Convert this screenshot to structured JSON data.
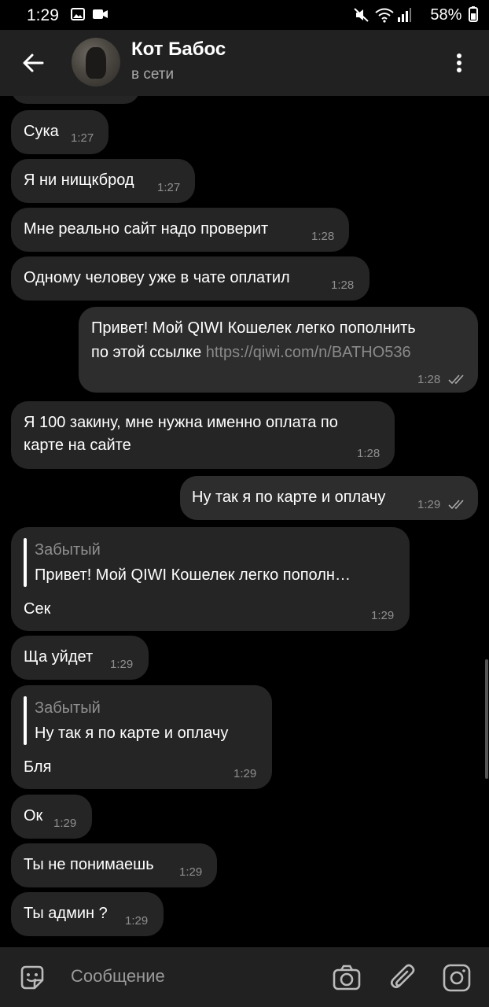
{
  "status_bar": {
    "time": "1:29",
    "battery": "58%",
    "icons": [
      "gallery-icon",
      "video-icon",
      "mute-icon",
      "wifi-icon",
      "signal-icon"
    ]
  },
  "header": {
    "contact_name": "Кот Бабос",
    "contact_status": "в сети",
    "back_icon": "arrow-left-icon",
    "menu_icon": "more-vert-icon"
  },
  "messages": [
    {
      "dir": "in",
      "text": "Сука",
      "time": "1:27"
    },
    {
      "dir": "in",
      "text": "Я ни нищкброд",
      "time": "1:27"
    },
    {
      "dir": "in",
      "text": "Мне реально сайт надо проверит",
      "time": "1:28"
    },
    {
      "dir": "in",
      "text": "Одному человеу уже в чате оплатил",
      "time": "1:28"
    },
    {
      "dir": "out",
      "text_line1": "Привет! Мой QIWI Кошелек легко пополнить",
      "text_line2": "по этой ссылке",
      "link": "https://qiwi.com/n/BATHO536",
      "time": "1:28",
      "read": true
    },
    {
      "dir": "in",
      "text_line1": "Я 100 закину, мне нужна именно оплата по",
      "text_line2": "карте на сайте",
      "time": "1:28"
    },
    {
      "dir": "out",
      "text": "Ну так я по карте и оплачу",
      "time": "1:29",
      "read": true
    },
    {
      "dir": "in",
      "reply_name": "Забытый",
      "reply_text": "Привет! Мой QIWI Кошелек легко пополн…",
      "text": "Сек",
      "time": "1:29"
    },
    {
      "dir": "in",
      "text": "Ща уйдет",
      "time": "1:29"
    },
    {
      "dir": "in",
      "reply_name": "Забытый",
      "reply_text": "Ну так я по карте и оплачу",
      "text": "Бля",
      "time": "1:29"
    },
    {
      "dir": "in",
      "text": "Ок",
      "time": "1:29"
    },
    {
      "dir": "in",
      "text": "Ты не понимаешь",
      "time": "1:29"
    },
    {
      "dir": "in",
      "text": "Ты админ ?",
      "time": "1:29"
    }
  ],
  "composer": {
    "placeholder": "Сообщение",
    "icons": [
      "sticker-icon",
      "camera-icon",
      "attach-icon",
      "instagram-icon"
    ]
  },
  "colors": {
    "background": "#000000",
    "header": "#212121",
    "bubble_in": "#252525",
    "bubble_out": "#2d2d2d",
    "muted_text": "#8f8f8f"
  }
}
